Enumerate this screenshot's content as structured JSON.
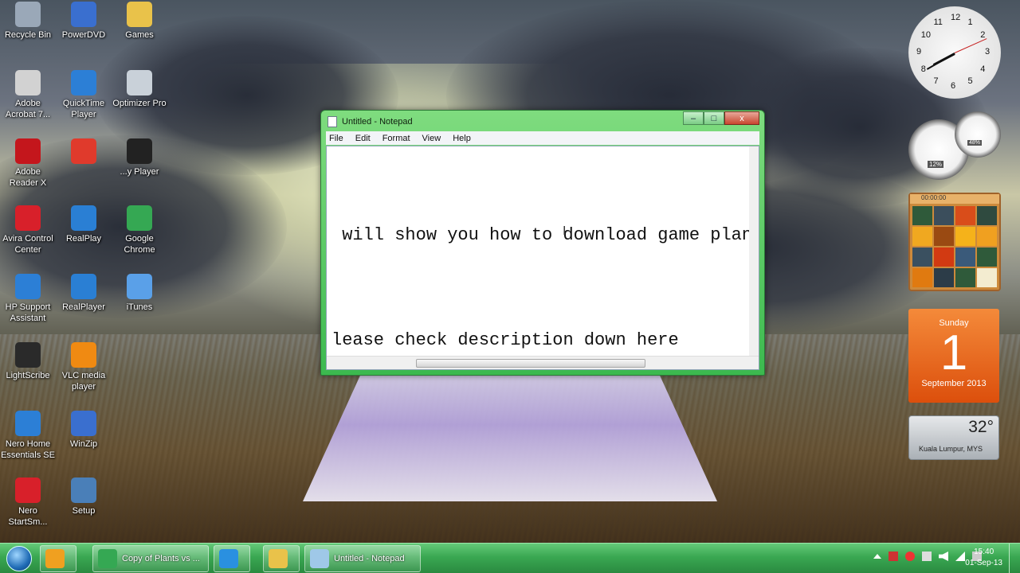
{
  "desktop_icons": [
    {
      "label": "Recycle Bin",
      "icon": "recycle-bin-icon",
      "color": "#9aa8b8"
    },
    {
      "label": "PowerDVD",
      "icon": "powerdvd-icon",
      "color": "#3a6fcf"
    },
    {
      "label": "Games",
      "icon": "folder-icon",
      "color": "#e9c24a"
    },
    {
      "label": "Adobe Acrobat 7...",
      "icon": "acrobat-icon",
      "color": "#d2d2d2"
    },
    {
      "label": "QuickTime Player",
      "icon": "quicktime-icon",
      "color": "#2c7fd6"
    },
    {
      "label": "Optimizer Pro",
      "icon": "optimizer-icon",
      "color": "#c9d1d9"
    },
    {
      "label": "Adobe Reader X",
      "icon": "adobe-reader-icon",
      "color": "#c4161c"
    },
    {
      "label": "",
      "icon": "app-icon",
      "color": "#e03a2c"
    },
    {
      "label": "...y Player",
      "icon": "player-icon",
      "color": "#222222"
    },
    {
      "label": "Avira Control Center",
      "icon": "avira-icon",
      "color": "#d8202a"
    },
    {
      "label": "RealPlay",
      "icon": "realplay-icon",
      "color": "#2a7fd4"
    },
    {
      "label": "Google Chrome",
      "icon": "chrome-icon",
      "color": "#35a853"
    },
    {
      "label": "HP Support Assistant",
      "icon": "hp-support-icon",
      "color": "#2c7fd6"
    },
    {
      "label": "RealPlayer",
      "icon": "realplayer-icon",
      "color": "#2a7fd4"
    },
    {
      "label": "iTunes",
      "icon": "itunes-icon",
      "color": "#5aa0e8"
    },
    {
      "label": "LightScribe",
      "icon": "lightscribe-icon",
      "color": "#2a2a2a"
    },
    {
      "label": "VLC media player",
      "icon": "vlc-icon",
      "color": "#f08a12"
    },
    {
      "label": "Nero Home Essentials SE",
      "icon": "nero-home-icon",
      "color": "#2c7fd6"
    },
    {
      "label": "WinZip",
      "icon": "winzip-icon",
      "color": "#3a6fcf"
    },
    {
      "label": "Nero StartSm...",
      "icon": "nero-start-icon",
      "color": "#d8202a"
    },
    {
      "label": "Setup",
      "icon": "setup-icon",
      "color": "#4a7fb8"
    }
  ],
  "notepad": {
    "title": "Untitled - Notepad",
    "menu": [
      "File",
      "Edit",
      "Format",
      "View",
      "Help"
    ],
    "line1": " will show you how to download game plan",
    "line2": "lease check description down here",
    "minimize": "–",
    "maximize": "□",
    "close": "x"
  },
  "gadgets": {
    "clock_numbers": [
      "12",
      "1",
      "2",
      "3",
      "4",
      "5",
      "6",
      "7",
      "8",
      "9",
      "10",
      "11"
    ],
    "cpu_percent": "12%",
    "mem_percent": "48%",
    "puzzle_time": "00:00:00",
    "calendar": {
      "weekday": "Sunday",
      "day": "1",
      "month": "September 2013"
    },
    "weather": {
      "temp": "32°",
      "location": "Kuala Lumpur, MYS"
    }
  },
  "taskbar": {
    "buttons": [
      {
        "label": "",
        "icon": "media-player-icon",
        "color": "#f0a020"
      },
      {
        "label": "Copy of Plants vs ...",
        "icon": "chrome-icon",
        "color": "#35a853"
      },
      {
        "label": "",
        "icon": "internet-explorer-icon",
        "color": "#2a90e0"
      },
      {
        "label": "",
        "icon": "explorer-folder-icon",
        "color": "#e9c24a"
      },
      {
        "label": "Untitled - Notepad",
        "icon": "notepad-icon",
        "color": "#9fc8e8"
      }
    ],
    "time": "15:40",
    "date": "01-Sep-13"
  }
}
